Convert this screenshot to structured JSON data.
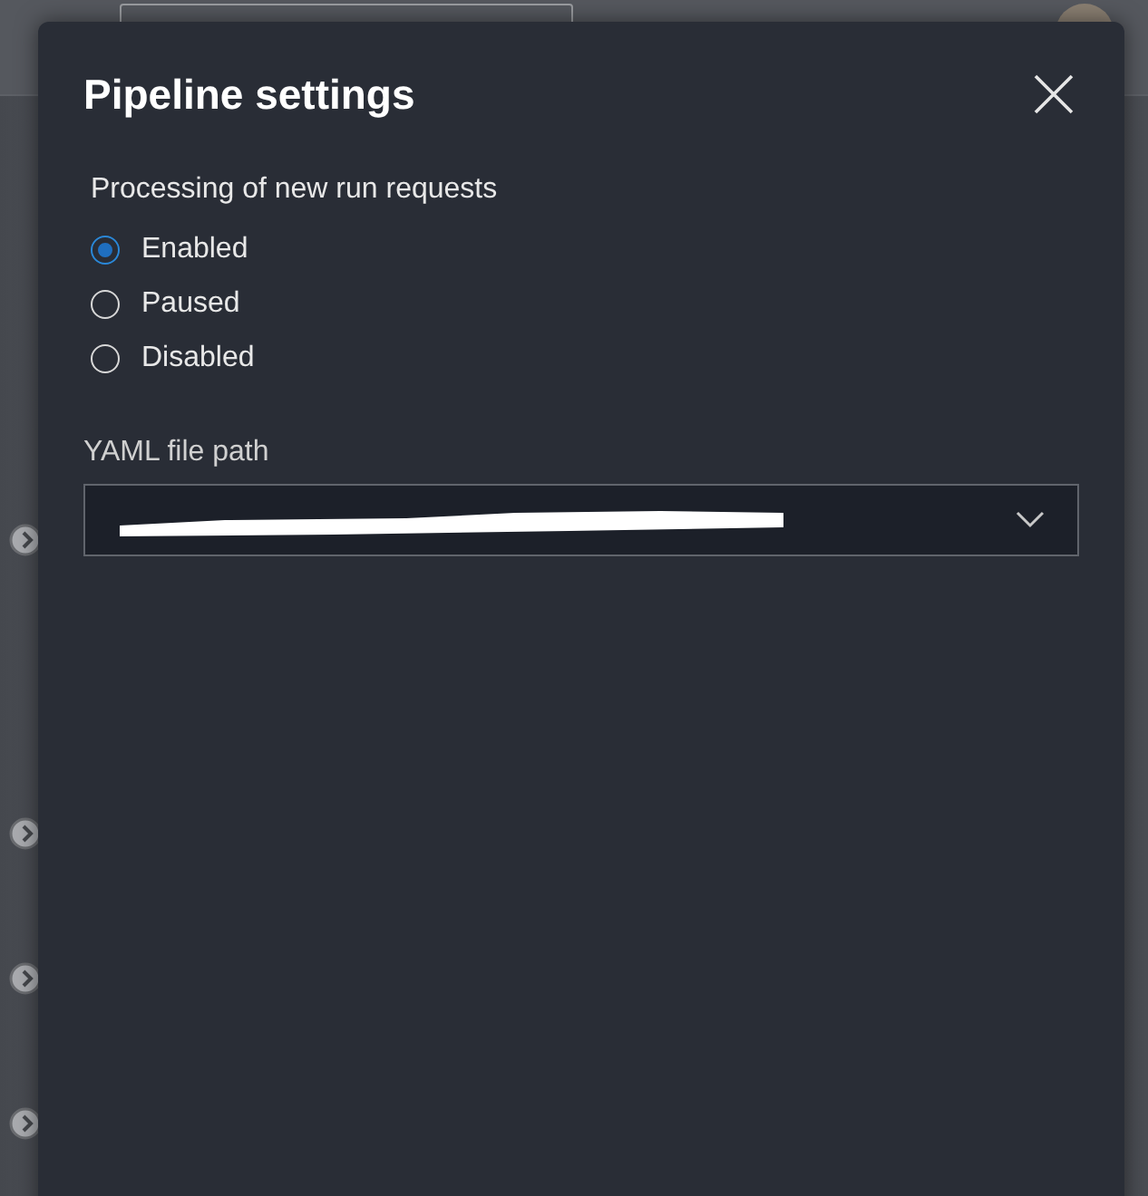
{
  "dialog": {
    "title": "Pipeline settings",
    "processing": {
      "label": "Processing of new run requests",
      "options": [
        {
          "label": "Enabled",
          "selected": true
        },
        {
          "label": "Paused",
          "selected": false
        },
        {
          "label": "Disabled",
          "selected": false
        }
      ]
    },
    "yaml_path": {
      "label": "YAML file path",
      "redacted": true
    }
  }
}
